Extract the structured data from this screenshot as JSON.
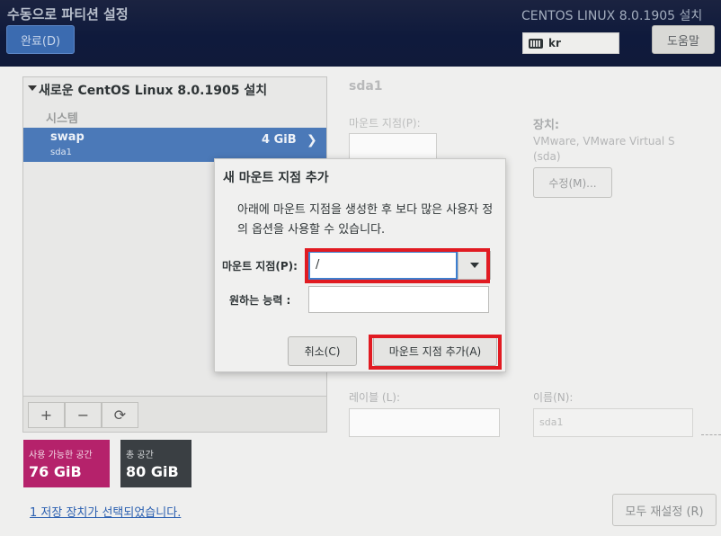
{
  "header": {
    "title": "수동으로 파티션 설정",
    "done_label": "완료(D)",
    "product": "CENTOS LINUX 8.0.1905 설치",
    "keyboard_layout": "kr",
    "help_label": "도움말"
  },
  "left_panel": {
    "install_title": "새로운 CentOS Linux 8.0.1905 설치",
    "group_label": "시스템",
    "items": [
      {
        "name": "swap",
        "device": "sda1",
        "size": "4 GiB",
        "selected": true
      }
    ],
    "toolbar": {
      "add": "+",
      "remove": "−",
      "reload": "⟳"
    }
  },
  "space": {
    "available_label": "사용 가능한 공간",
    "available_value": "76 GiB",
    "total_label": "총 공간",
    "total_value": "80 GiB"
  },
  "storage_link": "1  저장 장치가 선택되었습니다.",
  "reset_label": "모두 재설정 (R)",
  "detail": {
    "device_header": "sda1",
    "mount_point_label": "마운트 지점(P):",
    "device_label": "장치:",
    "device_value_line1": "VMware, VMware Virtual S",
    "device_value_line2": "(sda)",
    "modify_label": "수정(M)...",
    "label_label": "레이블 (L):",
    "name_label": "이름(N):",
    "name_value": "sda1"
  },
  "dialog": {
    "title": "새 마운트 지점 추가",
    "description": "아래에 마운트 지점을 생성한 후 보다 많은 사용자 정의 옵션을 사용할 수 있습니다.",
    "mount_point_label": "마운트 지점(P):",
    "mount_point_value": "/",
    "capacity_label": "원하는  능력 :",
    "capacity_value": "",
    "cancel_label": "취소(C)",
    "add_label": "마운트 지점 추가(A)",
    "highlight_color": "#e11b22"
  },
  "colors": {
    "accent": "#4b79b8",
    "available_badge": "#b5226b",
    "total_badge": "#3a3f43"
  }
}
